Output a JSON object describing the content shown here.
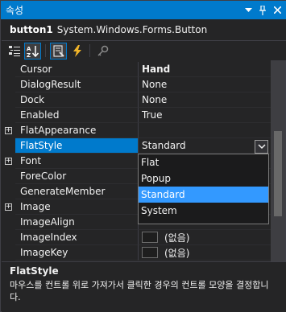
{
  "window": {
    "title": "속성"
  },
  "object": {
    "name": "button1",
    "type": "System.Windows.Forms.Button"
  },
  "toolbar": {
    "buttons": [
      {
        "icon": "categorized-icon"
      },
      {
        "icon": "alphabetical-icon",
        "active": true
      },
      {
        "icon": "properties-icon",
        "active": true
      },
      {
        "icon": "events-icon"
      },
      {
        "icon": "property-pages-icon"
      }
    ]
  },
  "properties": [
    {
      "name": "Cursor",
      "value": "Hand",
      "bold": true
    },
    {
      "name": "DialogResult",
      "value": "None"
    },
    {
      "name": "Dock",
      "value": "None"
    },
    {
      "name": "Enabled",
      "value": "True"
    },
    {
      "name": "FlatAppearance",
      "value": "",
      "expandable": true
    },
    {
      "name": "FlatStyle",
      "value": "Standard",
      "selected": true
    },
    {
      "name": "Font",
      "value": "",
      "expandable": true
    },
    {
      "name": "ForeColor",
      "value": ""
    },
    {
      "name": "GenerateMember",
      "value": ""
    },
    {
      "name": "Image",
      "value": "",
      "expandable": true
    },
    {
      "name": "ImageAlign",
      "value": ""
    },
    {
      "name": "ImageIndex",
      "value": "(없음)",
      "swatch": true
    },
    {
      "name": "ImageKey",
      "value": "(없음)",
      "swatch": true
    }
  ],
  "dropdown": {
    "options": [
      "Flat",
      "Popup",
      "Standard",
      "System"
    ],
    "selected": "Standard"
  },
  "description": {
    "title": "FlatStyle",
    "text": "마우스를 컨트롤 위로 가져가서 클릭한 경우의 컨트롤 모양을 결정합니다."
  },
  "colors": {
    "accent": "#007acc",
    "selection": "#3399ff",
    "background": "#252526"
  }
}
